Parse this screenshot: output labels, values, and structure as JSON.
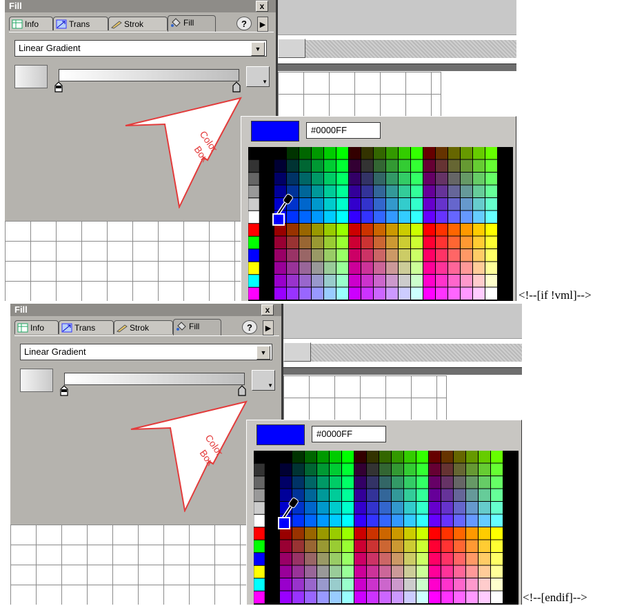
{
  "panel": {
    "title": "Fill",
    "close_label": "x",
    "tabs": [
      {
        "label": "Info",
        "icon": "info-grid-icon"
      },
      {
        "label": "Trans",
        "icon": "transform-icon"
      },
      {
        "label": "Strok",
        "icon": "pencil-icon"
      },
      {
        "label": "Fill",
        "icon": "paint-bucket-icon",
        "active": true
      }
    ],
    "help_label": "?",
    "more_label": "▶",
    "fill_type": "Linear Gradient"
  },
  "callout_text": [
    "Color",
    "Box"
  ],
  "picker": {
    "current_color": "#0000FF",
    "hex_value": "#0000FF"
  },
  "colors": {
    "panel_bg": "#b5b3ae",
    "accent_callout": "#e33b3b",
    "selected_color": "#0000ff"
  },
  "markers": {
    "before": "<!--[if !vml]-->",
    "after": "<!--[endif]-->"
  }
}
